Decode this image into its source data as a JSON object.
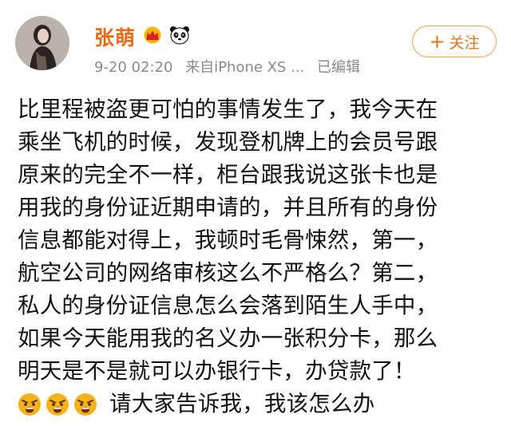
{
  "user": {
    "name": "张萌",
    "badges": [
      "crown-icon",
      "panda-icon"
    ]
  },
  "meta": {
    "time": "9-20 02:20",
    "source": "来自iPhone XS ...",
    "edited": "已编辑"
  },
  "follow_label": "关注",
  "post": {
    "lines": [
      "比里程被盗更可怕的事情发生了，我今天在",
      "乘坐飞机的时候，发现登机牌上的会员号跟",
      "原来的完全不一样，柜台跟我说这张卡也是",
      "用我的身份证近期申请的，并且所有的身份",
      "信息都能对得上，我顿时毛骨悚然，第一，",
      "航空公司的网络审核这么不严格么？第二，",
      "私人的身份证信息怎么会落到陌生人手中，",
      "如果今天能用我的名义办一张积分卡，那么",
      "明天是不是就可以办银行卡，办贷款了！"
    ],
    "last_line_emojis": [
      "angry-face-icon",
      "angry-face-icon",
      "angry-face-icon"
    ],
    "last_line_text": "请大家告诉我，我该怎么办"
  },
  "colors": {
    "name": "#e86a17",
    "follow": "#e5741b",
    "meta": "#8a8a8a",
    "text": "#111111"
  }
}
